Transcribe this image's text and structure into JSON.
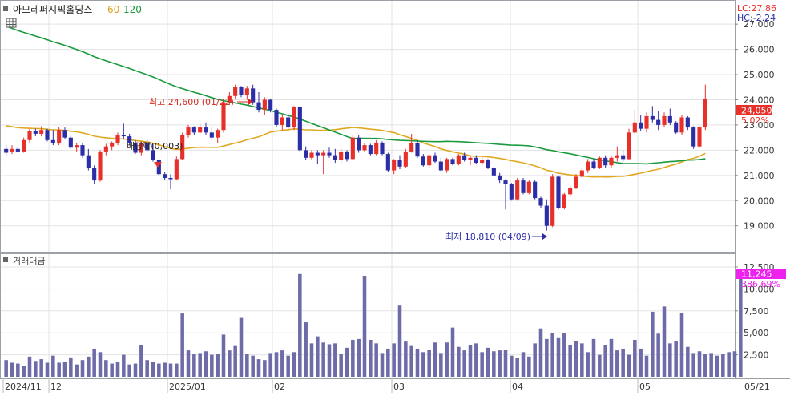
{
  "header": {
    "stock_name": "아모레퍼시픽홀딩스",
    "ma60_label": "60",
    "ma120_label": "120",
    "lc_label": "LC:27.86",
    "hc_label": "HC:-2.24"
  },
  "colors": {
    "up": "#e8302a",
    "down": "#2c2ea8",
    "ma60": "#1a9a3e",
    "ma120": "#e0a820",
    "volume": "#6e6ca8",
    "grid": "#e3e3e3",
    "current_price_bg": "#e8302a",
    "current_volume_bg": "#ee22ee"
  },
  "volume_panel": {
    "title": "거래대금"
  },
  "annotations": {
    "high_label": "최고 24,600 (01/22)",
    "low_label": "최저 18,810 (04/09)",
    "dividend_label": "배당락(0,003)",
    "current_price": "24,050",
    "current_change": "5.02%",
    "current_volume": "11,245",
    "current_volume_change": "386.69%"
  },
  "chart_data": [
    {
      "type": "candlestick",
      "title": "아모레퍼시픽홀딩스",
      "x_labels": [
        "2024/11",
        "12",
        "2025/01",
        "02",
        "03",
        "04",
        "05",
        "05/21"
      ],
      "y_ticks": [
        19000,
        20000,
        21000,
        22000,
        23000,
        24000,
        25000,
        26000,
        27000
      ],
      "y_tick_labels": [
        "19,000",
        "20,000",
        "21,000",
        "22,000",
        "23,000",
        "24,000",
        "25,000",
        "26,000",
        "27,000"
      ],
      "ylim": [
        18100,
        27800
      ],
      "grid": true,
      "series_names": [
        "60",
        "120"
      ],
      "high": {
        "value": 24600,
        "date": "01/22"
      },
      "low": {
        "value": 18810,
        "date": "04/09"
      },
      "last_close": 24050,
      "ohlc": [
        [
          22050,
          22200,
          21800,
          21900
        ],
        [
          21950,
          22200,
          21850,
          22050
        ],
        [
          22050,
          22150,
          21900,
          21950
        ],
        [
          21950,
          22500,
          21900,
          22400
        ],
        [
          22400,
          22850,
          22300,
          22750
        ],
        [
          22750,
          22850,
          22550,
          22650
        ],
        [
          22650,
          22950,
          22550,
          22800
        ],
        [
          22800,
          22850,
          22350,
          22400
        ],
        [
          22400,
          22800,
          22200,
          22300
        ],
        [
          22300,
          22900,
          22200,
          22800
        ],
        [
          22800,
          22900,
          22450,
          22500
        ],
        [
          22500,
          22600,
          22050,
          22100
        ],
        [
          22100,
          22300,
          21950,
          22200
        ],
        [
          22200,
          22300,
          21700,
          21800
        ],
        [
          21800,
          22050,
          21200,
          21300
        ],
        [
          21300,
          21400,
          20650,
          20800
        ],
        [
          20800,
          22000,
          20750,
          21950
        ],
        [
          21950,
          22250,
          21800,
          22150
        ],
        [
          22150,
          22350,
          22000,
          22300
        ],
        [
          22300,
          22700,
          22200,
          22600
        ],
        [
          22600,
          23050,
          22450,
          22550
        ],
        [
          22550,
          22650,
          22200,
          22300
        ],
        [
          22300,
          22400,
          21850,
          21900
        ],
        [
          21900,
          22350,
          21800,
          22300
        ],
        [
          22300,
          22450,
          21950,
          22000
        ],
        [
          22000,
          22250,
          21550,
          21600
        ],
        [
          21600,
          21650,
          21000,
          21050
        ],
        [
          21050,
          21150,
          20800,
          20900
        ],
        [
          20900,
          21050,
          20450,
          20850
        ],
        [
          20850,
          21750,
          20800,
          21650
        ],
        [
          21650,
          22700,
          21600,
          22600
        ],
        [
          22600,
          23000,
          22500,
          22900
        ],
        [
          22900,
          22950,
          22600,
          22700
        ],
        [
          22700,
          23050,
          22650,
          22900
        ],
        [
          22900,
          23100,
          22600,
          22700
        ],
        [
          22700,
          22900,
          22400,
          22500
        ],
        [
          22500,
          22850,
          22300,
          22800
        ],
        [
          22800,
          24000,
          22700,
          23900
        ],
        [
          23900,
          24300,
          23800,
          24150
        ],
        [
          24150,
          24600,
          24050,
          24500
        ],
        [
          24500,
          24550,
          24100,
          24200
        ],
        [
          24200,
          24550,
          24000,
          24450
        ],
        [
          24450,
          24600,
          23800,
          23900
        ],
        [
          23900,
          24300,
          23500,
          23600
        ],
        [
          23600,
          24100,
          23400,
          24000
        ],
        [
          24000,
          24050,
          23500,
          23600
        ],
        [
          23600,
          23650,
          22900,
          23000
        ],
        [
          23000,
          23400,
          22800,
          23300
        ],
        [
          23300,
          23450,
          22850,
          22900
        ],
        [
          22900,
          23750,
          22800,
          23700
        ],
        [
          23700,
          23750,
          21900,
          22000
        ],
        [
          22000,
          22150,
          21600,
          21700
        ],
        [
          21700,
          22000,
          21600,
          21900
        ],
        [
          21900,
          22000,
          21450,
          21800
        ],
        [
          21800,
          22000,
          21050,
          21900
        ],
        [
          21900,
          22100,
          21700,
          21800
        ],
        [
          21800,
          22050,
          21500,
          21600
        ],
        [
          21600,
          22050,
          21500,
          21950
        ],
        [
          21950,
          22000,
          21550,
          21650
        ],
        [
          21650,
          22600,
          21600,
          22500
        ],
        [
          22500,
          22600,
          21900,
          22000
        ],
        [
          22000,
          22300,
          21950,
          22200
        ],
        [
          22200,
          22250,
          21800,
          21850
        ],
        [
          21850,
          22400,
          21800,
          22300
        ],
        [
          22300,
          22350,
          21800,
          21850
        ],
        [
          21850,
          21900,
          21150,
          21200
        ],
        [
          21200,
          21650,
          21050,
          21600
        ],
        [
          21600,
          21800,
          21250,
          21350
        ],
        [
          21350,
          22050,
          21300,
          21950
        ],
        [
          21950,
          22650,
          21900,
          22300
        ],
        [
          22300,
          22400,
          21700,
          21750
        ],
        [
          21750,
          21850,
          21350,
          21400
        ],
        [
          21400,
          21850,
          21300,
          21800
        ],
        [
          21800,
          21900,
          21500,
          21550
        ],
        [
          21550,
          21700,
          21150,
          21200
        ],
        [
          21200,
          21700,
          21100,
          21650
        ],
        [
          21650,
          21700,
          21400,
          21450
        ],
        [
          21450,
          21850,
          21400,
          21800
        ],
        [
          21800,
          21900,
          21550,
          21600
        ],
        [
          21600,
          21750,
          21400,
          21700
        ],
        [
          21700,
          21800,
          21450,
          21500
        ],
        [
          21500,
          21750,
          21400,
          21600
        ],
        [
          21600,
          21650,
          21250,
          21300
        ],
        [
          21300,
          21350,
          20950,
          21000
        ],
        [
          21000,
          21100,
          20700,
          20800
        ],
        [
          20800,
          20850,
          19650,
          20650
        ],
        [
          20650,
          20700,
          20000,
          20050
        ],
        [
          20050,
          20900,
          20000,
          20800
        ],
        [
          20800,
          20900,
          20250,
          20300
        ],
        [
          20300,
          20800,
          20250,
          20750
        ],
        [
          20750,
          20800,
          20050,
          20100
        ],
        [
          20100,
          20150,
          19700,
          19800
        ],
        [
          19800,
          20050,
          18810,
          19000
        ],
        [
          19000,
          21050,
          18950,
          20950
        ],
        [
          20950,
          21000,
          19650,
          19700
        ],
        [
          19700,
          20300,
          19650,
          20250
        ],
        [
          20250,
          20600,
          20150,
          20500
        ],
        [
          20500,
          21050,
          20450,
          20950
        ],
        [
          20950,
          21300,
          20900,
          21200
        ],
        [
          21200,
          21650,
          21100,
          21550
        ],
        [
          21550,
          21650,
          21250,
          21300
        ],
        [
          21300,
          21750,
          21250,
          21700
        ],
        [
          21700,
          21800,
          21300,
          21400
        ],
        [
          21400,
          21800,
          21300,
          21700
        ],
        [
          21700,
          22150,
          21550,
          21800
        ],
        [
          21800,
          22000,
          21550,
          21650
        ],
        [
          21650,
          22850,
          21600,
          22700
        ],
        [
          22700,
          23600,
          22650,
          23100
        ],
        [
          23100,
          23400,
          22750,
          22850
        ],
        [
          22850,
          23500,
          22700,
          23350
        ],
        [
          23350,
          23750,
          23100,
          23200
        ],
        [
          23200,
          23550,
          22800,
          23000
        ],
        [
          23000,
          23500,
          22900,
          23350
        ],
        [
          23350,
          23650,
          23000,
          23100
        ],
        [
          23100,
          23150,
          22650,
          22700
        ],
        [
          22700,
          23400,
          22600,
          23300
        ],
        [
          23300,
          23350,
          22800,
          22900
        ],
        [
          22900,
          22950,
          22050,
          22150
        ],
        [
          22150,
          22950,
          22100,
          22900
        ],
        [
          22900,
          24600,
          22800,
          24050
        ]
      ]
    },
    {
      "type": "bar",
      "title": "거래대금",
      "y_ticks": [
        2500,
        5000,
        7500,
        10000,
        12500
      ],
      "y_tick_labels": [
        "2,500",
        "5,000",
        "7,500",
        "10,000",
        "12,500"
      ],
      "ylim": [
        0,
        12500
      ],
      "current_value": 11245,
      "values": [
        1900,
        1600,
        1500,
        1200,
        2300,
        1800,
        2000,
        1600,
        2400,
        1600,
        1700,
        2200,
        1400,
        1900,
        2300,
        3200,
        2800,
        1900,
        1500,
        1700,
        2500,
        1400,
        1500,
        3600,
        1900,
        1700,
        1500,
        1600,
        1500,
        1500,
        7200,
        3000,
        2600,
        2700,
        2900,
        2500,
        2600,
        4800,
        3000,
        3500,
        6700,
        2600,
        2400,
        2000,
        1900,
        2700,
        2800,
        3000,
        2400,
        2800,
        11700,
        6200,
        3800,
        4600,
        3900,
        3700,
        3800,
        2600,
        3300,
        4200,
        4300,
        11500,
        4200,
        3800,
        2700,
        3200,
        3800,
        8100,
        4000,
        3500,
        3200,
        2800,
        3100,
        3900,
        2700,
        3900,
        5600,
        3400,
        3000,
        3600,
        3800,
        2800,
        3300,
        2900,
        3000,
        3100,
        2400,
        2100,
        2800,
        2300,
        3800,
        5500,
        4300,
        5000,
        4400,
        5000,
        3600,
        4100,
        3800,
        2800,
        4300,
        2500,
        3600,
        4300,
        3000,
        3200,
        2500,
        4200,
        3200,
        2400,
        7400,
        4900,
        8000,
        3800,
        4100,
        7300,
        3400,
        2700,
        2900,
        2600,
        2700,
        2400,
        2600,
        2800,
        2900,
        11245
      ]
    }
  ]
}
